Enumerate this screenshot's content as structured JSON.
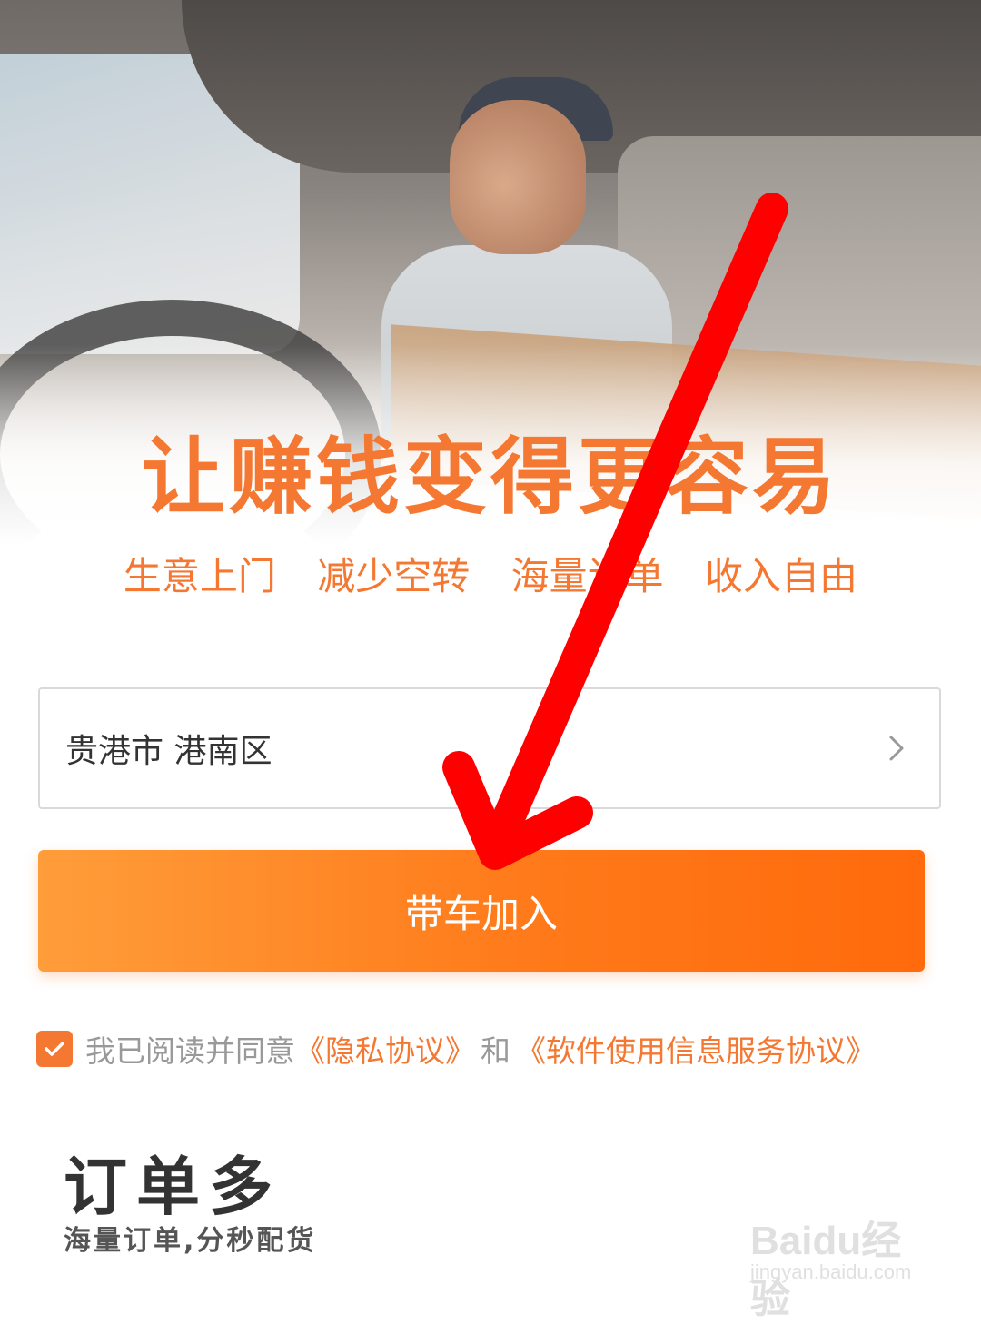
{
  "hero": {
    "headline": "让赚钱变得更容易",
    "tags": [
      "生意上门",
      "减少空转",
      "海量订单",
      "收入自由"
    ]
  },
  "city_select": {
    "value": "贵港市 港南区",
    "icon": "chevron-right-icon"
  },
  "join_button": {
    "label": "带车加入"
  },
  "agreement": {
    "checked": true,
    "prefix": "我已阅读并同意",
    "privacy_link": "《隐私协议》",
    "conjunction": "和",
    "service_link": "《软件使用信息服务协议》"
  },
  "feature": {
    "title": "订单多",
    "subtitle": "海量订单,分秒配货"
  },
  "watermark": {
    "brand": "Baidu经验",
    "url": "jingyan.baidu.com"
  },
  "colors": {
    "accent": "#f47832",
    "button_start": "#ff9d3a",
    "button_end": "#ff6a0c",
    "annotation_arrow": "#ff0000"
  }
}
